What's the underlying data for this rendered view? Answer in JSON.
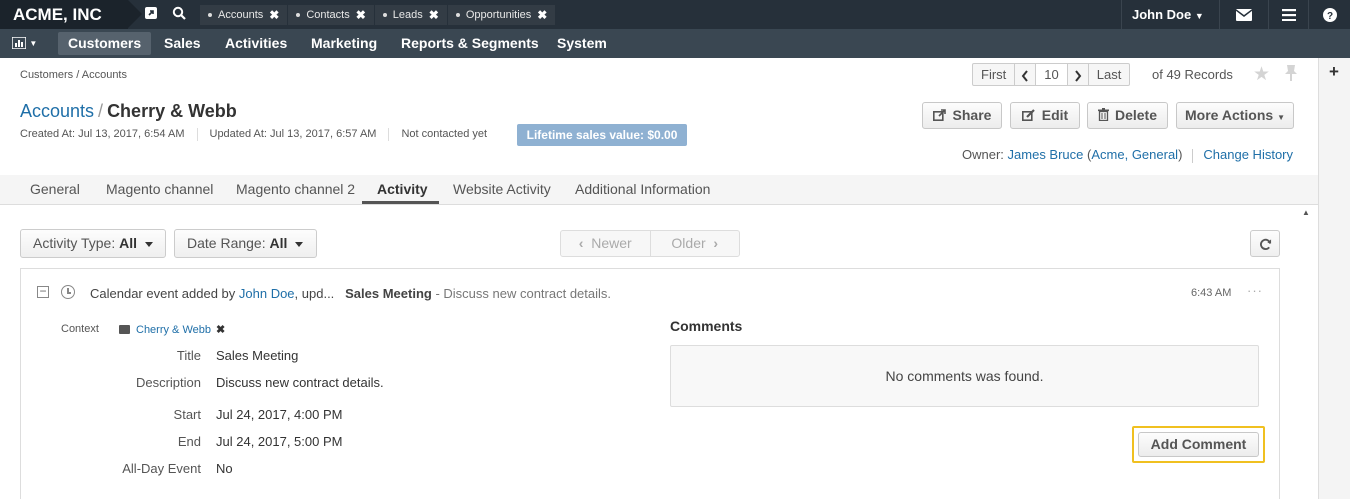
{
  "topbar": {
    "brand": "ACME, INC",
    "pinned_tabs": [
      {
        "label": "Accounts"
      },
      {
        "label": "Contacts"
      },
      {
        "label": "Leads"
      },
      {
        "label": "Opportunities"
      }
    ],
    "user": "John Doe"
  },
  "nav": {
    "items": [
      "Customers",
      "Sales",
      "Activities",
      "Marketing",
      "Reports & Segments",
      "System"
    ],
    "active": "Customers"
  },
  "header": {
    "breadcrumb": "Customers / Accounts",
    "pager": {
      "first": "First",
      "current": "10",
      "last": "Last",
      "records": "of 49 Records"
    },
    "title_crumb": "Accounts",
    "title_sep": "/",
    "title_name": "Cherry & Webb",
    "created": "Created At: Jul 13, 2017, 6:54 AM",
    "updated": "Updated At: Jul 13, 2017, 6:57 AM",
    "contacted": "Not contacted yet",
    "lifetime": "Lifetime sales value: $0.00",
    "buttons": {
      "share": "Share",
      "edit": "Edit",
      "delete": "Delete",
      "more": "More Actions"
    },
    "owner_label": "Owner:",
    "owner_name": "James Bruce",
    "owner_org": "Acme, General",
    "change_history": "Change History"
  },
  "tabs": [
    "General",
    "Magento channel",
    "Magento channel 2",
    "Activity",
    "Website Activity",
    "Additional Information"
  ],
  "active_tab": "Activity",
  "filters": {
    "activity_type_label": "Activity Type:",
    "activity_type_value": "All",
    "date_range_label": "Date Range:",
    "date_range_value": "All",
    "newer": "Newer",
    "older": "Older"
  },
  "activity": {
    "prefix": "Calendar event added by ",
    "author": "John Doe",
    "suffix": ", upd...",
    "title": "Sales Meeting",
    "desc": " - Discuss new contract details.",
    "time": "6:43 AM",
    "context_label": "Context",
    "context_value": "Cherry & Webb",
    "fields": [
      {
        "label": "Title",
        "value": "Sales Meeting"
      },
      {
        "label": "Description",
        "value": "Discuss new contract details."
      },
      {
        "label": "Start",
        "value": "Jul 24, 2017, 4:00 PM"
      },
      {
        "label": "End",
        "value": "Jul 24, 2017, 5:00 PM"
      },
      {
        "label": "All-Day Event",
        "value": "No"
      }
    ],
    "comments_heading": "Comments",
    "no_comments": "No comments was found.",
    "add_comment": "Add Comment"
  },
  "colors": {
    "link": "#1f6fa8",
    "topbar": "#26303a",
    "navbar": "#3a4752",
    "lifetime_badge": "#8fb1d2",
    "focus_outline": "#f0c020"
  }
}
